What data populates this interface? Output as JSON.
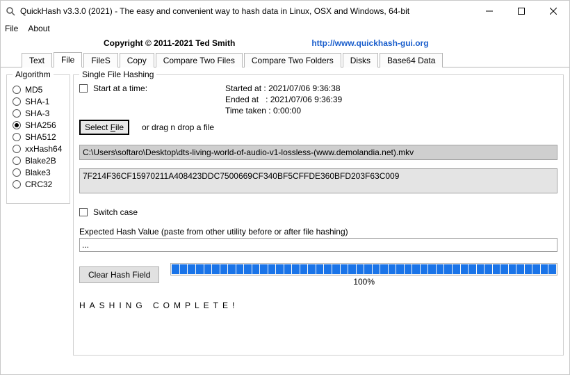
{
  "window": {
    "title": "QuickHash v3.3.0 (2021) - The easy and convenient way to hash data in Linux, OSX and Windows, 64-bit"
  },
  "menu": {
    "file": "File",
    "about": "About"
  },
  "header": {
    "copyright": "Copyright © 2011-2021  Ted Smith",
    "url": "http://www.quickhash-gui.org"
  },
  "tabs": [
    "Text",
    "File",
    "FileS",
    "Copy",
    "Compare Two Files",
    "Compare Two Folders",
    "Disks",
    "Base64 Data"
  ],
  "activeTab": 1,
  "algo": {
    "legend": "Algorithm",
    "items": [
      "MD5",
      "SHA-1",
      "SHA-3",
      "SHA256",
      "SHA512",
      "xxHash64",
      "Blake2B",
      "Blake3",
      "CRC32"
    ],
    "selected": 3
  },
  "panel": {
    "legend": "Single File Hashing",
    "startAtTime": "Start at a time:",
    "startedLabel": "Started at",
    "startedValue": "2021/07/06 9:36:38",
    "endedLabel": "Ended at",
    "endedValue": "2021/07/06 9:36:39",
    "timeTakenLabel": "Time taken",
    "timeTakenValue": "0:00:00",
    "colon": ":",
    "selectFile": "Select File",
    "dragText": "or drag n drop a file",
    "filePath": "C:\\Users\\softaro\\Desktop\\dts-living-world-of-audio-v1-lossless-(www.demolandia.net).mkv",
    "hash": "7F214F36CF15970211A408423DDC7500669CF340BF5CFFDE360BFD203F63C009",
    "switchCase": "Switch case",
    "expectedLabel": "Expected Hash Value (paste from other utility before or after file hashing)",
    "expectedValue": "...",
    "clearBtn": "Clear Hash Field",
    "progressPct": "100%",
    "status": "HASHING COMPLETE!"
  }
}
